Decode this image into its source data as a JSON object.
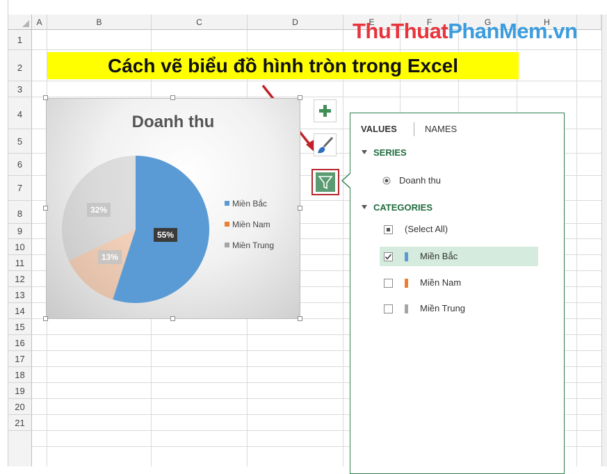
{
  "spreadsheet": {
    "columns": [
      "A",
      "B",
      "C",
      "D",
      "E",
      "F",
      "G",
      "H"
    ],
    "rows": [
      "1",
      "2",
      "3",
      "4",
      "5",
      "6",
      "7",
      "8",
      "9",
      "10",
      "11",
      "12",
      "13",
      "14",
      "15",
      "16",
      "17",
      "18",
      "19",
      "20",
      "21"
    ]
  },
  "watermark": {
    "part1": "ThuThuat",
    "part2": "PhanMem.vn"
  },
  "banner": {
    "title": "Cách vẽ biểu đồ hình tròn trong Excel",
    "color": "#ffff00"
  },
  "chart": {
    "title": "Doanh thu",
    "labels": {
      "bac": "55%",
      "nam": "13%",
      "trung": "32%"
    }
  },
  "chart_data": {
    "type": "pie",
    "title": "Doanh thu",
    "categories": [
      "Miền Bắc",
      "Miền Nam",
      "Miền Trung"
    ],
    "values": [
      55,
      13,
      32
    ],
    "colors": [
      "#5b9bd5",
      "#ed7d31",
      "#a5a5a5"
    ],
    "data_labels": [
      "55%",
      "13%",
      "32%"
    ],
    "filtered_out": [
      "Miền Nam",
      "Miền Trung"
    ],
    "legend_position": "right"
  },
  "chart_tools": {
    "elements_icon": "plus-icon",
    "styles_icon": "brush-icon",
    "filter_icon": "funnel-icon"
  },
  "filter_panel": {
    "tabs": {
      "values": "VALUES",
      "names": "NAMES"
    },
    "series_header": "SERIES",
    "series": [
      {
        "label": "Doanh thu",
        "selected": true
      }
    ],
    "categories_header": "CATEGORIES",
    "select_all": "(Select All)",
    "categories": [
      {
        "label": "Miền Bắc",
        "checked": true,
        "color": "#5b9bd5"
      },
      {
        "label": "Miền Nam",
        "checked": false,
        "color": "#ed7d31"
      },
      {
        "label": "Miền Trung",
        "checked": false,
        "color": "#a5a5a5"
      }
    ]
  }
}
